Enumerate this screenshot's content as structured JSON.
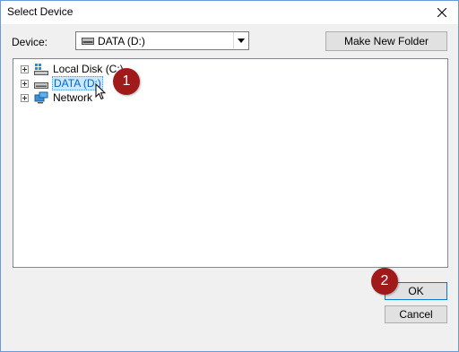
{
  "window": {
    "title": "Select Device"
  },
  "device": {
    "label": "Device:",
    "selected": "DATA (D:)"
  },
  "buttons": {
    "new_folder": "Make New Folder",
    "ok": "OK",
    "cancel": "Cancel"
  },
  "tree": {
    "items": [
      {
        "label": "Local Disk (C:)",
        "icon": "system-drive-icon",
        "selected": false
      },
      {
        "label": "DATA (D:)",
        "icon": "drive-icon",
        "selected": true
      },
      {
        "label": "Network",
        "icon": "network-icon",
        "selected": false
      }
    ]
  },
  "markers": {
    "one": "1",
    "two": "2"
  },
  "colors": {
    "marker": "#a01a1a",
    "selection": "#cce8ff",
    "accent": "#0078d7"
  }
}
